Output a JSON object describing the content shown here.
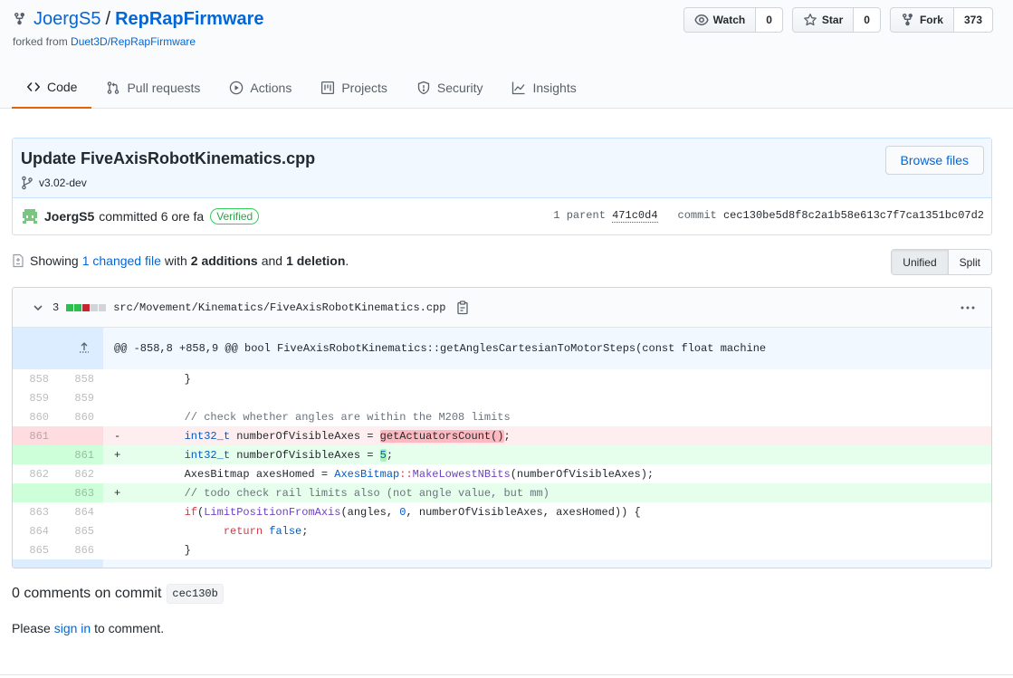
{
  "repo": {
    "owner": "JoergS5",
    "separator": "/",
    "name": "RepRapFirmware",
    "forked_prefix": "forked from",
    "forked_source": "Duet3D/RepRapFirmware"
  },
  "actions": {
    "watch": {
      "label": "Watch",
      "count": "0"
    },
    "star": {
      "label": "Star",
      "count": "0"
    },
    "fork": {
      "label": "Fork",
      "count": "373"
    }
  },
  "nav": {
    "tabs": [
      {
        "label": "Code",
        "icon": "code-icon"
      },
      {
        "label": "Pull requests",
        "icon": "pull-request-icon"
      },
      {
        "label": "Actions",
        "icon": "play-icon"
      },
      {
        "label": "Projects",
        "icon": "project-icon"
      },
      {
        "label": "Security",
        "icon": "shield-icon"
      },
      {
        "label": "Insights",
        "icon": "graph-icon"
      }
    ],
    "selected": "Code"
  },
  "commit": {
    "title": "Update FiveAxisRobotKinematics.cpp",
    "branch": "v3.02-dev",
    "browse_label": "Browse files",
    "author": "JoergS5",
    "committed_text": "committed 6 ore fa",
    "verified_label": "Verified",
    "parent_label": "1 parent",
    "parent_sha": "471c0d4",
    "commit_label": "commit",
    "commit_sha": "cec130be5d8f8c2a1b58e613c7f7ca1351bc07d2"
  },
  "toc": {
    "showing": "Showing",
    "changed": "1 changed file",
    "with": "with",
    "additions": "2 additions",
    "and": "and",
    "deletions": "1 deletion",
    "period": "."
  },
  "view": {
    "unified": "Unified",
    "split": "Split",
    "active": "Unified"
  },
  "file": {
    "change_count": "3",
    "path": "src/Movement/Kinematics/FiveAxisRobotKinematics.cpp",
    "hunk_header": "@@ -858,8 +858,9 @@ bool FiveAxisRobotKinematics::getAnglesCartesianToMotorSteps(const float machine",
    "lines": [
      {
        "old": "858",
        "new": "858",
        "type": "ctx"
      },
      {
        "old": "859",
        "new": "859",
        "type": "ctx"
      },
      {
        "old": "860",
        "new": "860",
        "type": "ctx"
      },
      {
        "old": "861",
        "new": "",
        "type": "del"
      },
      {
        "old": "",
        "new": "861",
        "type": "add"
      },
      {
        "old": "862",
        "new": "862",
        "type": "ctx"
      },
      {
        "old": "",
        "new": "863",
        "type": "add"
      },
      {
        "old": "863",
        "new": "864",
        "type": "ctx"
      },
      {
        "old": "864",
        "new": "865",
        "type": "ctx"
      },
      {
        "old": "865",
        "new": "866",
        "type": "ctx"
      }
    ],
    "code": {
      "l858": "}",
      "l860": "// check whether angles are within the M208 limits",
      "l861_del_type": "int32_t",
      "l861_del_var": " numberOfVisibleAxes = ",
      "l861_del_call": "getActuatorsCount()",
      "l861_del_end": ";",
      "l861_add_type": "int32_t",
      "l861_add_var": " numberOfVisibleAxes = ",
      "l861_add_num": "5",
      "l861_add_end": ";",
      "l862_a": "AxesBitmap axesHomed = ",
      "l862_b": "AxesBitmap",
      "l862_c": "::",
      "l862_d": "MakeLowestNBits",
      "l862_e": "(numberOfVisibleAxes);",
      "l863_comment": "// todo check rail limits also (not angle value, but mm)",
      "l864_if": "if",
      "l864_paren": "(",
      "l864_fn": "LimitPositionFromAxis",
      "l864_a": "(angles, ",
      "l864_zero": "0",
      "l864_b": ", numberOfVisibleAxes, axesHomed)) {",
      "l865_ret": "return",
      "l865_false": "false",
      "l865_end": ";",
      "l866": "}",
      "minus": "-",
      "plus": "+"
    }
  },
  "comments": {
    "count_text": "0 comments on commit",
    "short_sha": "cec130b",
    "please": "Please",
    "sign_in": "sign in",
    "to_comment": "to comment."
  },
  "colors": {
    "link": "#0366d6",
    "addition": "#e6ffed",
    "deletion": "#ffeef0",
    "accent_tab": "#e36209",
    "verified": "#28a745"
  }
}
